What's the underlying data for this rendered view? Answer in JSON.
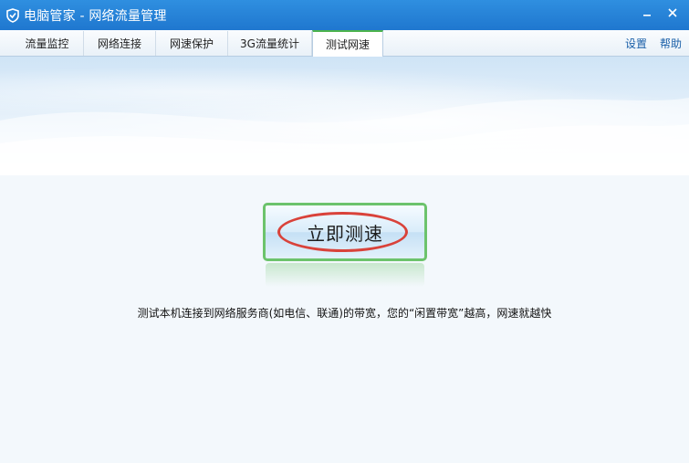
{
  "window": {
    "title": "电脑管家 - 网络流量管理",
    "icon": "shield-icon",
    "controls": [
      "minimize-icon",
      "close-icon"
    ]
  },
  "tabs": [
    {
      "label": "流量监控",
      "active": false
    },
    {
      "label": "网络连接",
      "active": false
    },
    {
      "label": "网速保护",
      "active": false
    },
    {
      "label": "3G流量统计",
      "active": false
    },
    {
      "label": "测试网速",
      "active": true
    }
  ],
  "top_links": {
    "settings": "设置",
    "help": "帮助"
  },
  "main": {
    "test_button_label": "立即测速",
    "description": "测试本机连接到网络服务商(如电信、联通)的带宽，您的“闲置带宽”越高，网速就越快"
  },
  "colors": {
    "titlebar": "#2f8fe0",
    "active_tab_accent": "#4db34d",
    "button_border": "#6cc36c",
    "annotation": "#d9423a",
    "link": "#1a5fa8"
  }
}
